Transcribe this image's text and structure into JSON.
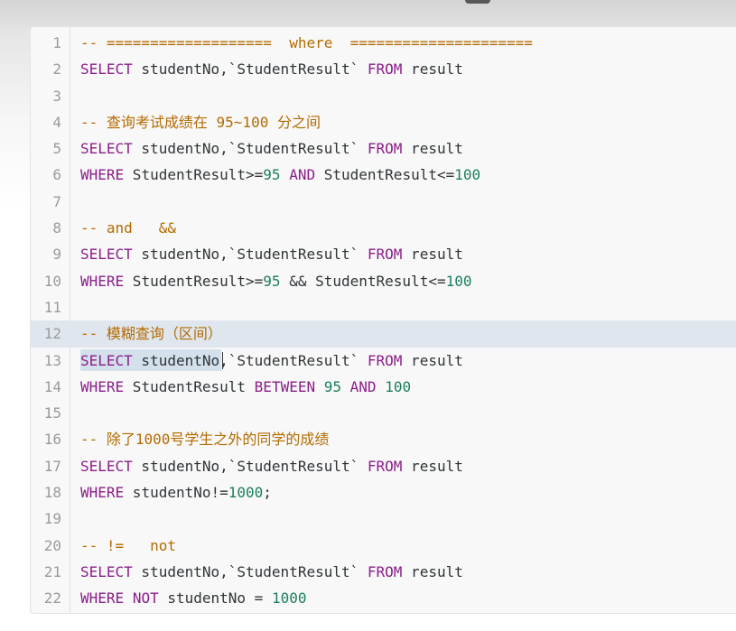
{
  "editor": {
    "lines": [
      {
        "num": "1",
        "tokens": [
          {
            "t": "-- ===================  where  =====================",
            "c": "comment"
          }
        ]
      },
      {
        "num": "2",
        "tokens": [
          {
            "t": "SELECT",
            "c": "keyword"
          },
          {
            "t": " studentNo,`StudentResult` ",
            "c": "plain"
          },
          {
            "t": "FROM",
            "c": "keyword"
          },
          {
            "t": " result",
            "c": "plain"
          }
        ]
      },
      {
        "num": "3",
        "tokens": []
      },
      {
        "num": "4",
        "tokens": [
          {
            "t": "-- 查询考试成绩在 95~100 分之间",
            "c": "comment"
          }
        ]
      },
      {
        "num": "5",
        "tokens": [
          {
            "t": "SELECT",
            "c": "keyword"
          },
          {
            "t": " studentNo,`StudentResult` ",
            "c": "plain"
          },
          {
            "t": "FROM",
            "c": "keyword"
          },
          {
            "t": " result",
            "c": "plain"
          }
        ]
      },
      {
        "num": "6",
        "tokens": [
          {
            "t": "WHERE",
            "c": "keyword"
          },
          {
            "t": " StudentResult>=",
            "c": "plain"
          },
          {
            "t": "95",
            "c": "number"
          },
          {
            "t": " ",
            "c": "plain"
          },
          {
            "t": "AND",
            "c": "keyword"
          },
          {
            "t": " StudentResult<=",
            "c": "plain"
          },
          {
            "t": "100",
            "c": "number"
          }
        ]
      },
      {
        "num": "7",
        "tokens": []
      },
      {
        "num": "8",
        "tokens": [
          {
            "t": "-- and   &&",
            "c": "comment"
          }
        ]
      },
      {
        "num": "9",
        "tokens": [
          {
            "t": "SELECT",
            "c": "keyword"
          },
          {
            "t": " studentNo,`StudentResult` ",
            "c": "plain"
          },
          {
            "t": "FROM",
            "c": "keyword"
          },
          {
            "t": " result",
            "c": "plain"
          }
        ]
      },
      {
        "num": "10",
        "tokens": [
          {
            "t": "WHERE",
            "c": "keyword"
          },
          {
            "t": " StudentResult>=",
            "c": "plain"
          },
          {
            "t": "95",
            "c": "number"
          },
          {
            "t": " && StudentResult<=",
            "c": "plain"
          },
          {
            "t": "100",
            "c": "number"
          }
        ]
      },
      {
        "num": "11",
        "tokens": []
      },
      {
        "num": "12",
        "tokens": [
          {
            "t": "-- 模糊查询（区间）",
            "c": "comment"
          }
        ],
        "active": true
      },
      {
        "num": "13",
        "tokens": [
          {
            "t": "SELECT",
            "c": "keyword"
          },
          {
            "t": " studentNo,`StudentResult` ",
            "c": "plain"
          },
          {
            "t": "FROM",
            "c": "keyword"
          },
          {
            "t": " result",
            "c": "plain"
          }
        ],
        "selection": true
      },
      {
        "num": "14",
        "tokens": [
          {
            "t": "WHERE",
            "c": "keyword"
          },
          {
            "t": " StudentResult ",
            "c": "plain"
          },
          {
            "t": "BETWEEN",
            "c": "keyword"
          },
          {
            "t": " ",
            "c": "plain"
          },
          {
            "t": "95",
            "c": "number"
          },
          {
            "t": " ",
            "c": "plain"
          },
          {
            "t": "AND",
            "c": "keyword"
          },
          {
            "t": " ",
            "c": "plain"
          },
          {
            "t": "100",
            "c": "number"
          }
        ]
      },
      {
        "num": "15",
        "tokens": []
      },
      {
        "num": "16",
        "tokens": [
          {
            "t": "-- 除了1000号学生之外的同学的成绩",
            "c": "comment"
          }
        ]
      },
      {
        "num": "17",
        "tokens": [
          {
            "t": "SELECT",
            "c": "keyword"
          },
          {
            "t": " studentNo,`StudentResult` ",
            "c": "plain"
          },
          {
            "t": "FROM",
            "c": "keyword"
          },
          {
            "t": " result",
            "c": "plain"
          }
        ]
      },
      {
        "num": "18",
        "tokens": [
          {
            "t": "WHERE",
            "c": "keyword"
          },
          {
            "t": " studentNo!=",
            "c": "plain"
          },
          {
            "t": "1000",
            "c": "number"
          },
          {
            "t": ";",
            "c": "plain"
          }
        ]
      },
      {
        "num": "19",
        "tokens": []
      },
      {
        "num": "20",
        "tokens": [
          {
            "t": "-- !=   not",
            "c": "comment"
          }
        ]
      },
      {
        "num": "21",
        "tokens": [
          {
            "t": "SELECT",
            "c": "keyword"
          },
          {
            "t": " studentNo,`StudentResult` ",
            "c": "plain"
          },
          {
            "t": "FROM",
            "c": "keyword"
          },
          {
            "t": " result",
            "c": "plain"
          }
        ]
      },
      {
        "num": "22",
        "tokens": [
          {
            "t": "WHERE",
            "c": "keyword"
          },
          {
            "t": " ",
            "c": "plain"
          },
          {
            "t": "NOT",
            "c": "keyword"
          },
          {
            "t": " studentNo = ",
            "c": "plain"
          },
          {
            "t": "1000",
            "c": "number"
          }
        ]
      }
    ]
  },
  "colors": {
    "comment": "#b36b00",
    "keyword": "#8a1e8a",
    "number": "#1a7f5a",
    "plain": "#2f3437",
    "gutter": "#9a9a9a",
    "active_line": "#dfe6ee"
  }
}
